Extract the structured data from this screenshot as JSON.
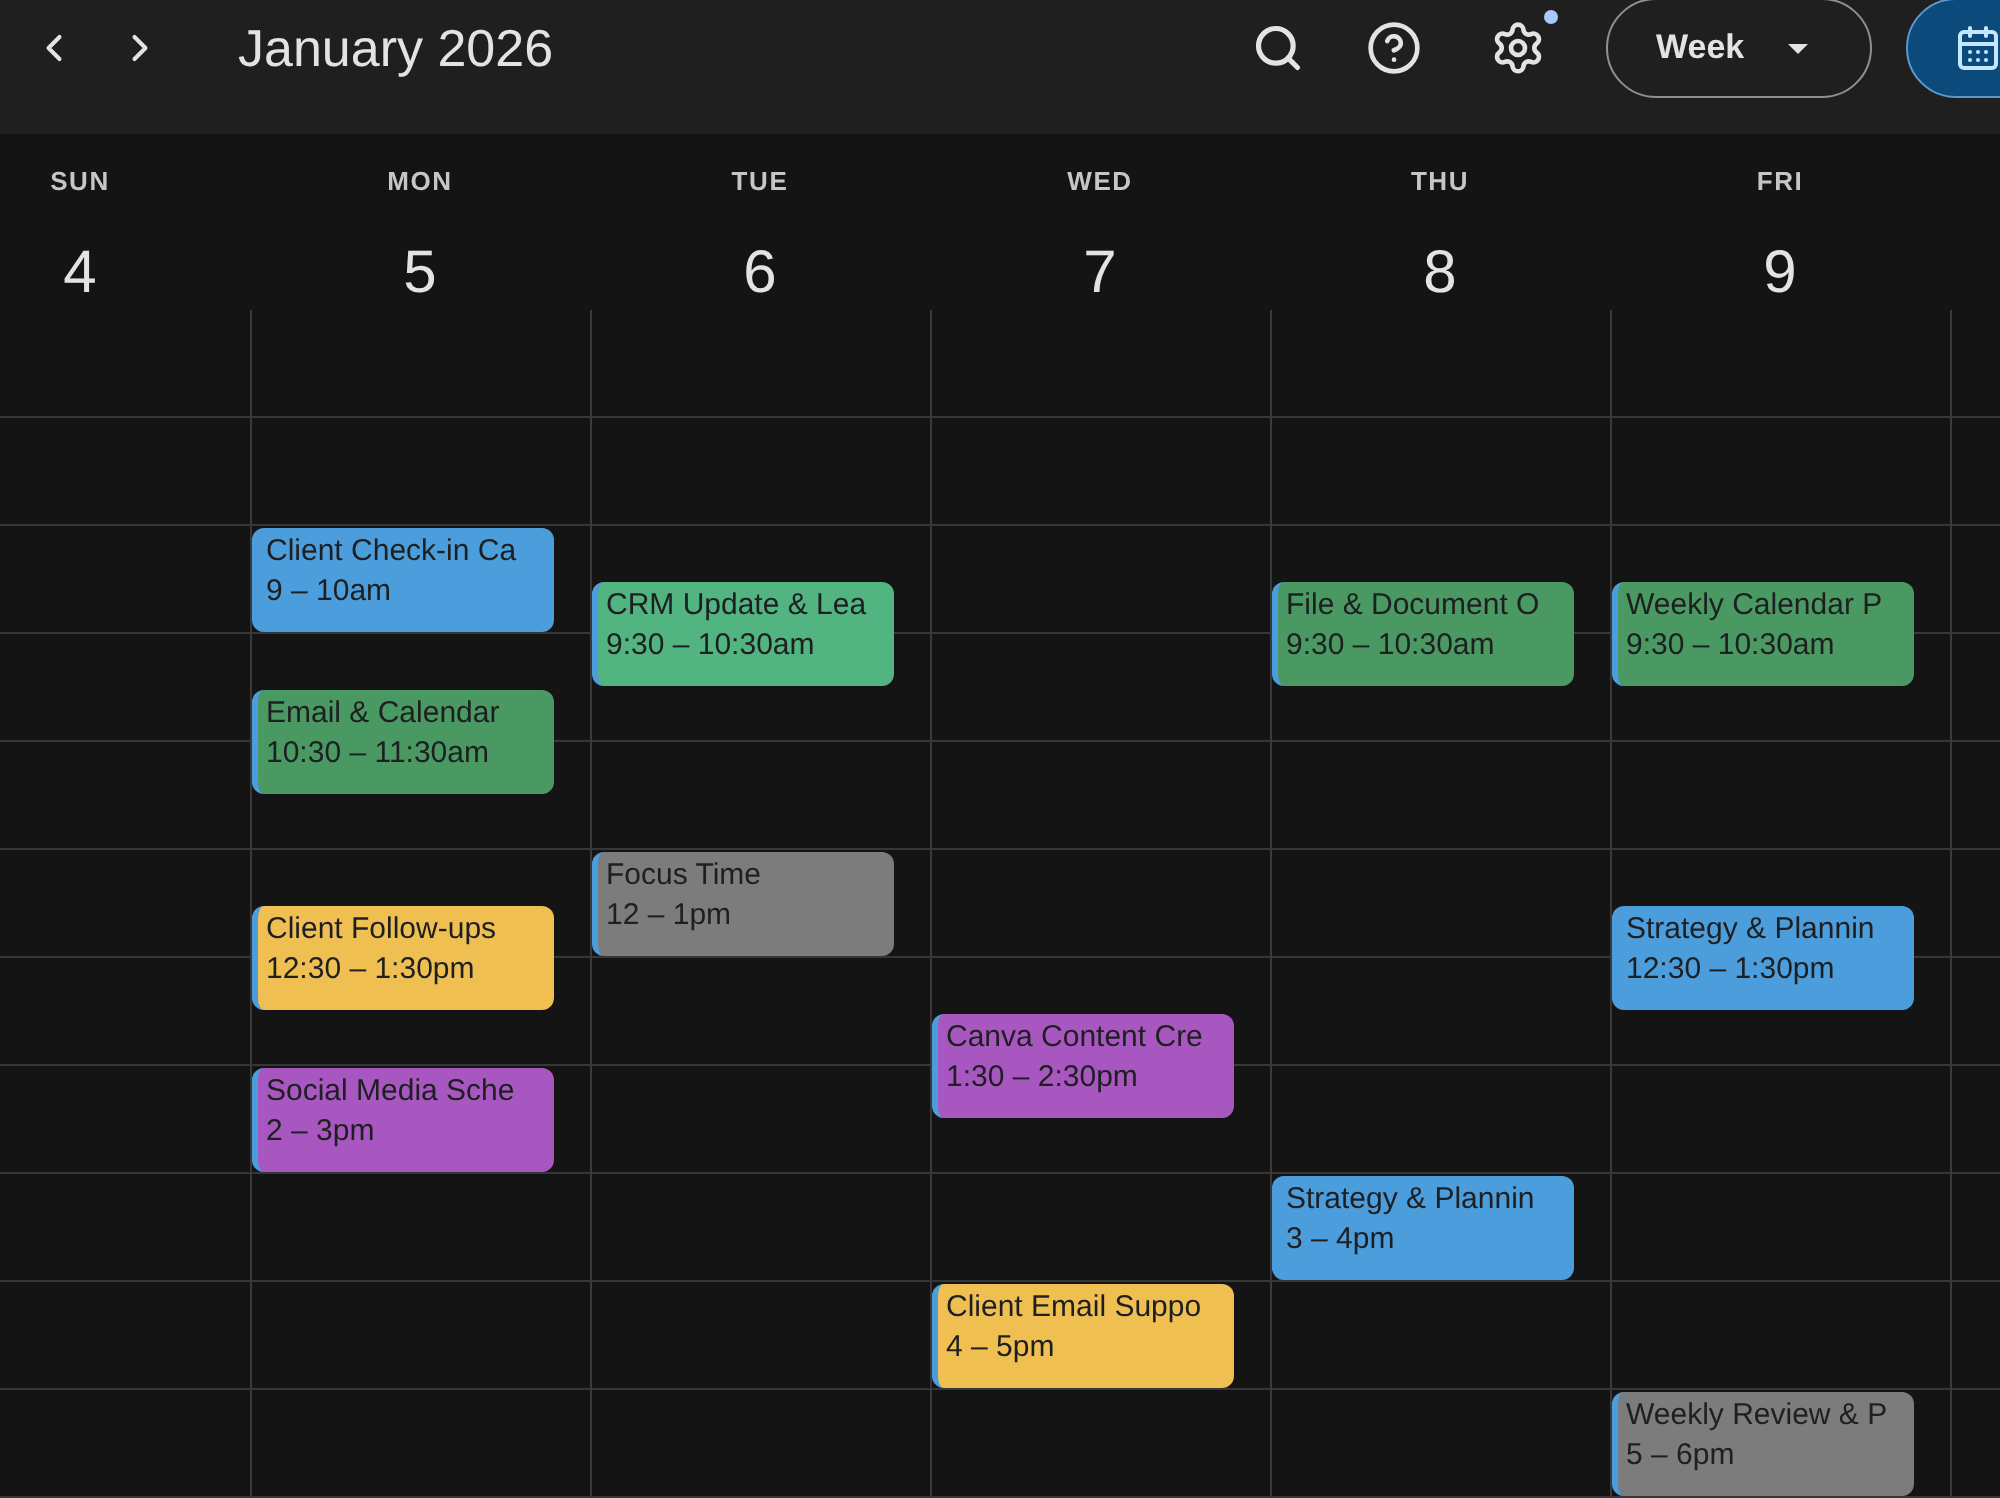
{
  "top_bar": {
    "title": "January 2026",
    "settings_notification": true,
    "view_button": {
      "label": "Week"
    }
  },
  "days": [
    {
      "weekday": "SUN",
      "date": "4"
    },
    {
      "weekday": "MON",
      "date": "5",
      "events": [
        {
          "title": "Client Check-in Ca",
          "time": "9 – 10am",
          "color": "#4c9ddc"
        },
        {
          "title": "Email & Calendar",
          "time": "10:30 – 11:30am",
          "color": "#4a9862"
        },
        {
          "title": "Client Follow-ups",
          "time": "12:30 – 1:30pm",
          "color": "#efbf52"
        },
        {
          "title": "Social Media Sche",
          "time": "2 – 3pm",
          "color": "#a857c0"
        }
      ]
    },
    {
      "weekday": "TUE",
      "date": "6",
      "events": [
        {
          "title": "CRM Update & Lea",
          "time": "9:30 – 10:30am",
          "color": "#52b481"
        },
        {
          "title": "Focus Time",
          "time": "12 – 1pm",
          "color": "#7c7c7c"
        }
      ]
    },
    {
      "weekday": "WED",
      "date": "7",
      "events": [
        {
          "title": "Canva Content Cre",
          "time": "1:30 – 2:30pm",
          "color": "#a857c0"
        },
        {
          "title": "Client Email Suppo",
          "time": "4 – 5pm",
          "color": "#efbf52"
        }
      ]
    },
    {
      "weekday": "THU",
      "date": "8",
      "events": [
        {
          "title": "File & Document O",
          "time": "9:30 – 10:30am",
          "color": "#4a9862"
        },
        {
          "title": "Strategy & Plannin",
          "time": "3 – 4pm",
          "color": "#4c9ddc"
        }
      ]
    },
    {
      "weekday": "FRI",
      "date": "9",
      "events": [
        {
          "title": "Weekly Calendar P",
          "time": "9:30 – 10:30am",
          "color": "#4a9862"
        },
        {
          "title": "Strategy & Plannin",
          "time": "12:30 – 1:30pm",
          "color": "#4c9ddc"
        },
        {
          "title": "Weekly Review & P",
          "time": "5 – 6pm",
          "color": "#7c7c7c"
        }
      ]
    }
  ]
}
